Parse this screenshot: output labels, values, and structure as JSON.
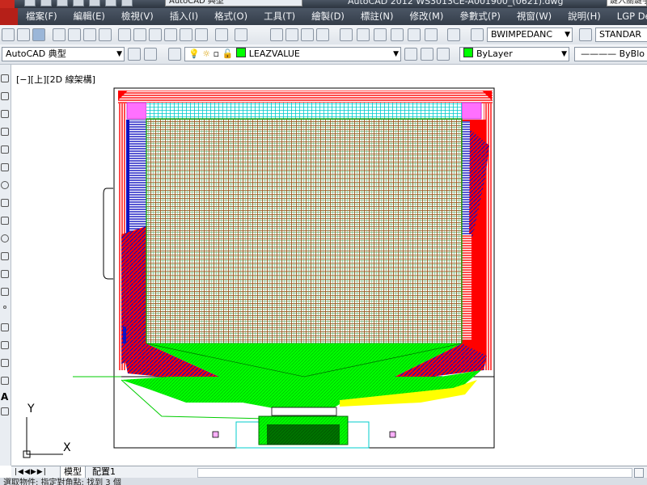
{
  "titlebar": {
    "workspace": "AutoCAD 典型",
    "title": "AutoCAD 2012    WS3013CE-A001900_(0621).dwg",
    "search_placeholder": "鍵入關鍵字"
  },
  "menu": [
    "檔案(F)",
    "編輯(E)",
    "檢視(V)",
    "插入(I)",
    "格式(O)",
    "工具(T)",
    "繪製(D)",
    "標註(N)",
    "修改(M)",
    "參數式(P)",
    "視窗(W)",
    "說明(H)",
    "LGP Design"
  ],
  "toolbar1": {
    "dimstyle": "BWIMPEDANC",
    "textstyle": "STANDAR"
  },
  "toolbar2": {
    "workspace": "AutoCAD 典型",
    "layer": "LEAZVALUE",
    "color": "ByLayer",
    "linetype": "ByBlo"
  },
  "viewport": {
    "label": "[−][上][2D 線架構]",
    "ucs_x": "X",
    "ucs_y": "Y"
  },
  "tabs": {
    "model": "模型",
    "layout": "配置1"
  },
  "status": "選取物件:   指定對角點:  找到 3 個",
  "colors": {
    "red": "#ff0000",
    "green": "#00ff00",
    "blue": "#1010c0",
    "cyan": "#00e0e0",
    "magenta": "#ff60ff",
    "brown": "#8a4a10",
    "yellow": "#ffff00"
  }
}
